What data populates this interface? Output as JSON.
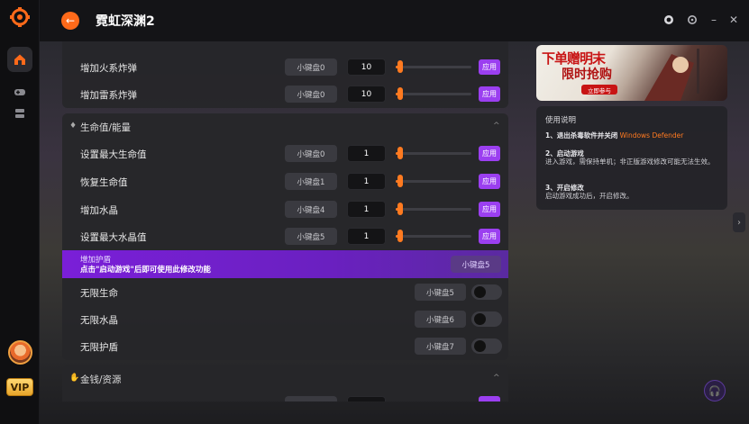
{
  "app": {
    "title": "霓虹深渊2"
  },
  "colors": {
    "accent": "#ff6a1a",
    "purple": "#9b3ff0",
    "bg": "#141417"
  },
  "rail": {
    "items": [
      {
        "icon": "home-icon"
      },
      {
        "icon": "gamepad-icon"
      },
      {
        "icon": "database-icon"
      }
    ],
    "vip": "VIP"
  },
  "sections": {
    "top": {
      "rows": [
        {
          "label": "增加火系炸弹",
          "key": "小键盘0",
          "value": "10",
          "apply": "应用",
          "level": 0.05
        },
        {
          "label": "增加雷系炸弹",
          "key": "小键盘0",
          "value": "10",
          "apply": "应用",
          "level": 0.05
        }
      ]
    },
    "life": {
      "title": "生命值/能量",
      "rows": [
        {
          "label": "设置最大生命值",
          "key": "小键盘0",
          "value": "1",
          "apply": "应用",
          "level": 0.05
        },
        {
          "label": "恢复生命值",
          "key": "小键盘1",
          "value": "1",
          "apply": "应用",
          "level": 0.05
        },
        {
          "label": "增加水晶",
          "key": "小键盘4",
          "value": "1",
          "apply": "应用",
          "level": 0.05
        },
        {
          "label": "设置最大水晶值",
          "key": "小键盘5",
          "value": "1",
          "apply": "应用",
          "level": 0.05
        }
      ],
      "hover": {
        "label": "增加护盾",
        "hint": "点击\"启动游戏\"后即可使用此修改功能",
        "key": "小键盘5"
      },
      "toggles": [
        {
          "label": "无限生命",
          "key": "小键盘5",
          "on": false
        },
        {
          "label": "无限水晶",
          "key": "小键盘6",
          "on": false
        },
        {
          "label": "无限护盾",
          "key": "小键盘7",
          "on": false
        }
      ]
    },
    "money": {
      "title": "金钱/资源"
    }
  },
  "banner": {
    "line1": "下单赠明末",
    "line2": "限时抢购",
    "tag": "立即参与"
  },
  "instructions": {
    "title": "使用说明",
    "s1": "1、退出杀毒软件并关闭",
    "s1_accent": "Windows Defender",
    "s2_title": "2、启动游戏",
    "s2_body": "进入游戏，需保持单机；非正版游戏修改可能无法生效。",
    "s3_title": "3、开启修改",
    "s3_body": "启动游戏成功后，开启修改。"
  }
}
